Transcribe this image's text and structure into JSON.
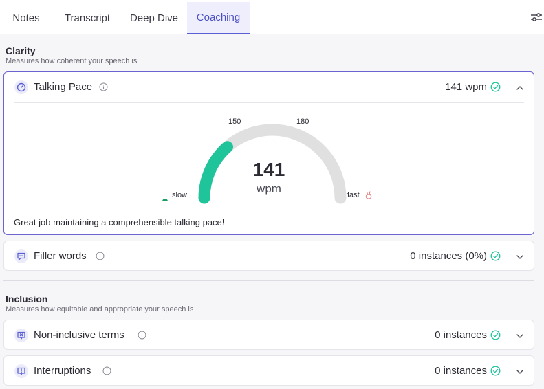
{
  "tabs": [
    {
      "label": "Notes"
    },
    {
      "label": "Transcript"
    },
    {
      "label": "Deep Dive"
    },
    {
      "label": "Coaching"
    }
  ],
  "active_tab": "Coaching",
  "clarity": {
    "title": "Clarity",
    "subtitle": "Measures how coherent your speech is",
    "talking_pace": {
      "name": "Talking Pace",
      "value": "141 wpm",
      "gauge": {
        "value_number": "141",
        "unit": "wpm",
        "tick_low": "150",
        "tick_high": "180",
        "slow_label": "slow",
        "fast_label": "fast",
        "fill_fraction": 0.27,
        "fill_color": "#1fc49a",
        "track_color": "#e0e0e0"
      },
      "feedback": "Great job maintaining a comprehensible talking pace!"
    },
    "filler_words": {
      "name": "Filler words",
      "value": "0 instances (0%)"
    }
  },
  "inclusion": {
    "title": "Inclusion",
    "subtitle": "Measures how equitable and appropriate your speech is",
    "non_inclusive": {
      "name": "Non-inclusive terms",
      "value": "0 instances"
    },
    "interruptions": {
      "name": "Interruptions",
      "value": "0 instances"
    }
  },
  "colors": {
    "accent": "#5a5fd6",
    "success": "#1fc49a"
  }
}
